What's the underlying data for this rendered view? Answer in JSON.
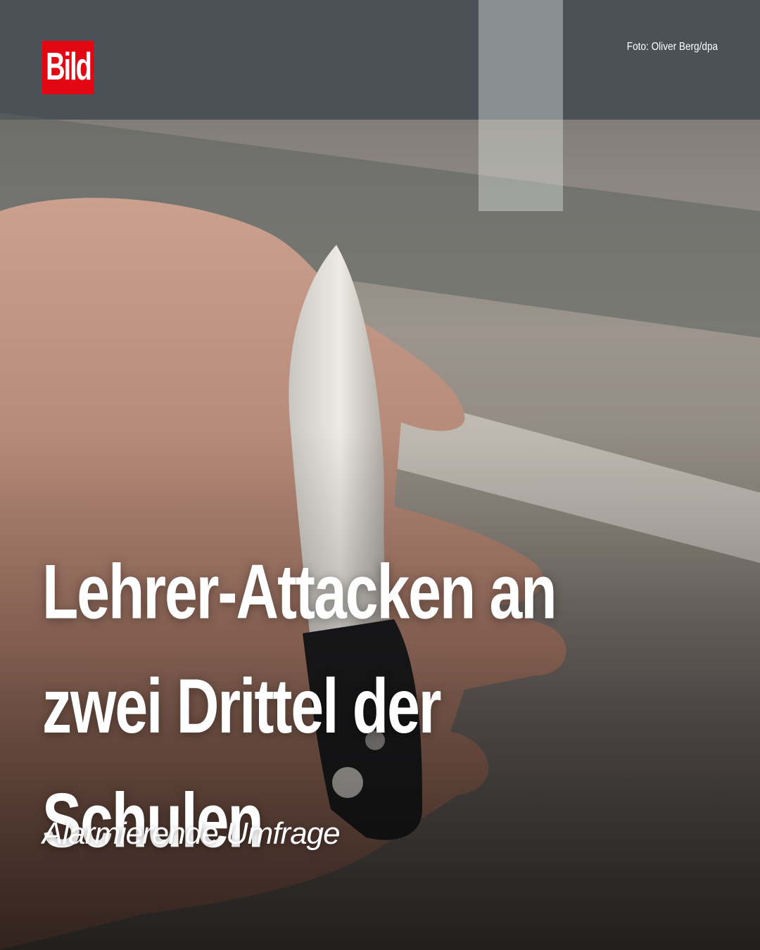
{
  "brand": {
    "logo_text": "Bild",
    "logo_color": "#e30613"
  },
  "photo": {
    "credit": "Foto: Oliver Berg/dpa",
    "subject": "hand-holding-folding-knife"
  },
  "article": {
    "headline_lines": [
      "Lehrer-Attacken an",
      "zwei Drittel der",
      "Schulen"
    ],
    "subline": "Alarmierende Umfrage"
  },
  "colors": {
    "text": "#ffffff"
  }
}
